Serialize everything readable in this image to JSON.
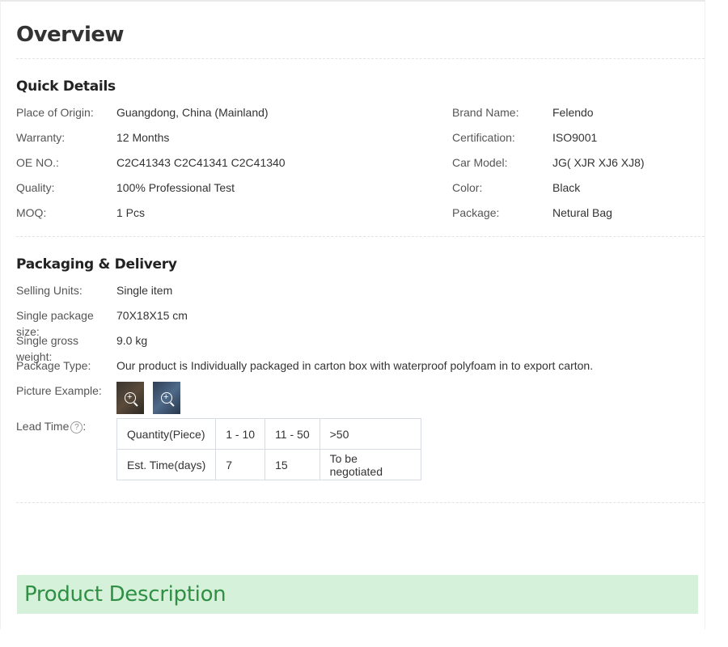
{
  "overview_title": "Overview",
  "quick_details": {
    "title": "Quick Details",
    "left": [
      {
        "label": "Place of Origin:",
        "value": "Guangdong, China (Mainland)"
      },
      {
        "label": "Warranty:",
        "value": "12 Months"
      },
      {
        "label": "OE NO.:",
        "value": "C2C41343 C2C41341 C2C41340"
      },
      {
        "label": "Quality:",
        "value": "100% Professional Test"
      },
      {
        "label": "MOQ:",
        "value": "1 Pcs"
      }
    ],
    "right": [
      {
        "label": "Brand Name:",
        "value": "Felendo"
      },
      {
        "label": "Certification:",
        "value": "ISO9001"
      },
      {
        "label": "Car Model:",
        "value": "JG( XJR XJ6 XJ8)"
      },
      {
        "label": "Color:",
        "value": "Black"
      },
      {
        "label": "Package:",
        "value": "Netural Bag"
      }
    ]
  },
  "packaging": {
    "title": "Packaging & Delivery",
    "rows": [
      {
        "label": "Selling Units:",
        "value": "Single item"
      },
      {
        "label": "Single package size:",
        "value": "70X18X15 cm"
      },
      {
        "label": "Single gross weight:",
        "value": "9.0 kg"
      },
      {
        "label": "Package Type:",
        "value": "Our product is Individually packaged in carton box with waterproof polyfoam in to export carton."
      }
    ],
    "picture_label": "Picture Example:",
    "pictures": [
      {
        "icon": "zoom-icon"
      },
      {
        "icon": "zoom-icon"
      }
    ],
    "lead_time_label": "Lead Time",
    "help_glyph": "?",
    "lead_table": {
      "header": [
        "Quantity(Piece)",
        "1 - 10",
        "11 - 50",
        ">50"
      ],
      "row": [
        "Est. Time(days)",
        "7",
        "15",
        "To be negotiated"
      ]
    }
  },
  "product_description": "Product Description",
  "colors": {
    "accent_green": "#2f8f45",
    "description_bg": "#d5f1d9",
    "divider": "#e3e3e3"
  }
}
